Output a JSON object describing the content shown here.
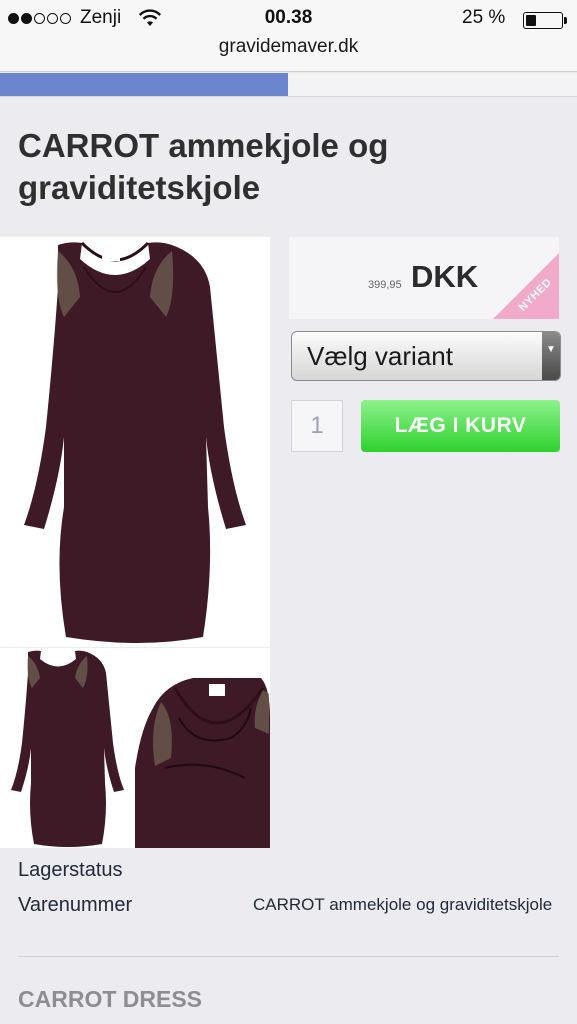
{
  "status_bar": {
    "signal_dots_filled": 2,
    "signal_dots_total": 5,
    "carrier": "Zenji",
    "time": "00.38",
    "battery_percent": "25 %",
    "battery_level": 0.25
  },
  "browser": {
    "url": "gravidemaver.dk"
  },
  "product": {
    "title": "CARROT ammekjole og graviditetskjole",
    "price_amount": "399,95",
    "price_currency": "DKK",
    "badge": "NYHED",
    "variant_select_label": "Vælg variant",
    "quantity": "1",
    "add_to_cart_label": "LÆG I KURV",
    "images": [
      {
        "icon": "dress-front-image"
      },
      {
        "icon": "dress-thumbnail-front"
      },
      {
        "icon": "dress-thumbnail-nursing-detail"
      }
    ]
  },
  "details": {
    "stock_label": "Lagerstatus",
    "sku_label": "Varenummer",
    "sku_value": "CARROT ammekjole og graviditetskjole"
  },
  "description": {
    "heading": "CARROT DRESS"
  },
  "colors": {
    "nav_active": "#6b86cf",
    "cart_button": "#3bd43a",
    "badge": "#f2aacb",
    "dress": "#3e1a26"
  }
}
